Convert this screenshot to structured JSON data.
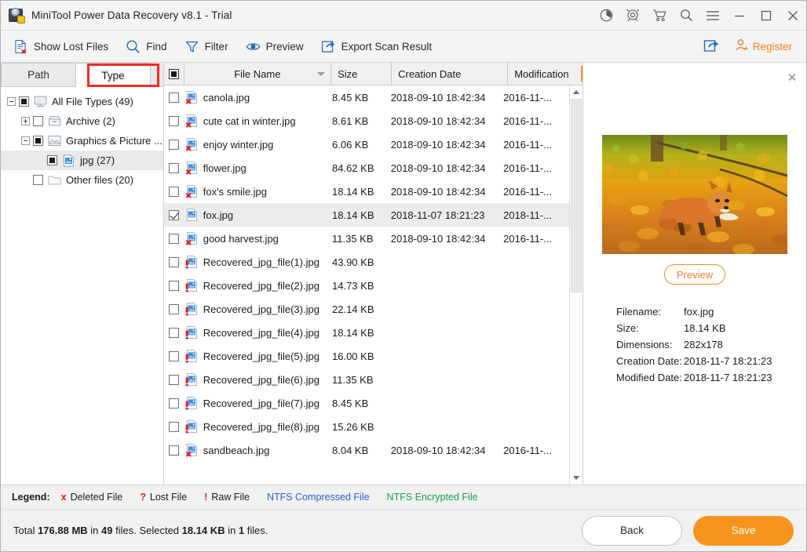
{
  "window": {
    "title": "MiniTool Power Data Recovery v8.1 - Trial",
    "app_icon": "minitool-logo-icon",
    "controls": [
      {
        "name": "disc-icon",
        "label": "Disc"
      },
      {
        "name": "support-headset-icon",
        "label": "Support"
      },
      {
        "name": "shopping-cart-icon",
        "label": "Buy"
      },
      {
        "name": "magnifier-icon",
        "label": "Search"
      },
      {
        "name": "hamburger-menu-icon",
        "label": "Menu"
      },
      {
        "name": "minimize-icon",
        "label": "Minimize"
      },
      {
        "name": "maximize-icon",
        "label": "Maximize"
      },
      {
        "name": "close-icon",
        "label": "Close"
      }
    ]
  },
  "toolbar": {
    "show_lost_files": "Show Lost Files",
    "find": "Find",
    "filter": "Filter",
    "preview": "Preview",
    "export_scan_result": "Export Scan Result",
    "register": "Register",
    "share_icon": "share-export-icon"
  },
  "tabs": {
    "path": "Path",
    "type": "Type",
    "active": "Type",
    "highlight_color": "#fb2a22"
  },
  "tree": [
    {
      "label": "All File Types (49)",
      "depth": 0,
      "expander": "minus",
      "check": "partial",
      "icon": "monitor-icon",
      "selected": false
    },
    {
      "label": "Archive (2)",
      "depth": 1,
      "expander": "plus",
      "check": "empty",
      "icon": "archive-icon",
      "selected": false
    },
    {
      "label": "Graphics & Picture ...",
      "depth": 1,
      "expander": "minus",
      "check": "partial",
      "icon": "picture-icon",
      "selected": false
    },
    {
      "label": "jpg (27)",
      "depth": 2,
      "expander": "none",
      "check": "partial",
      "icon": "jpg-file-icon",
      "selected": true
    },
    {
      "label": "Other files (20)",
      "depth": 1,
      "expander": "none",
      "check": "empty",
      "icon": "folder-icon",
      "selected": false
    }
  ],
  "filelist": {
    "columns": [
      "File Name",
      "Size",
      "Creation Date",
      "Modification"
    ],
    "header_checkbox": "partial",
    "sort_icon": "sort-descending-icon",
    "rows": [
      {
        "name": "canola.jpg",
        "size": "8.45 KB",
        "created": "2018-09-10 18:42:34",
        "modified": "2016-11-...",
        "status": "deleted",
        "checked": false,
        "selected": false
      },
      {
        "name": "cute cat in winter.jpg",
        "size": "8.61 KB",
        "created": "2018-09-10 18:42:34",
        "modified": "2016-11-...",
        "status": "deleted",
        "checked": false,
        "selected": false
      },
      {
        "name": "enjoy winter.jpg",
        "size": "6.06 KB",
        "created": "2018-09-10 18:42:34",
        "modified": "2016-11-...",
        "status": "deleted",
        "checked": false,
        "selected": false
      },
      {
        "name": "flower.jpg",
        "size": "84.62 KB",
        "created": "2018-09-10 18:42:34",
        "modified": "2016-11-...",
        "status": "deleted",
        "checked": false,
        "selected": false
      },
      {
        "name": "fox's smile.jpg",
        "size": "18.14 KB",
        "created": "2018-09-10 18:42:34",
        "modified": "2016-11-...",
        "status": "deleted",
        "checked": false,
        "selected": false
      },
      {
        "name": "fox.jpg",
        "size": "18.14 KB",
        "created": "2018-11-07 18:21:23",
        "modified": "2018-11-...",
        "status": "normal",
        "checked": true,
        "selected": true
      },
      {
        "name": "good harvest.jpg",
        "size": "11.35 KB",
        "created": "2018-09-10 18:42:34",
        "modified": "2016-11-...",
        "status": "deleted",
        "checked": false,
        "selected": false
      },
      {
        "name": "Recovered_jpg_file(1).jpg",
        "size": "43.90 KB",
        "created": "",
        "modified": "",
        "status": "raw",
        "checked": false,
        "selected": false
      },
      {
        "name": "Recovered_jpg_file(2).jpg",
        "size": "14.73 KB",
        "created": "",
        "modified": "",
        "status": "raw",
        "checked": false,
        "selected": false
      },
      {
        "name": "Recovered_jpg_file(3).jpg",
        "size": "22.14 KB",
        "created": "",
        "modified": "",
        "status": "raw",
        "checked": false,
        "selected": false
      },
      {
        "name": "Recovered_jpg_file(4).jpg",
        "size": "18.14 KB",
        "created": "",
        "modified": "",
        "status": "raw",
        "checked": false,
        "selected": false
      },
      {
        "name": "Recovered_jpg_file(5).jpg",
        "size": "16.00 KB",
        "created": "",
        "modified": "",
        "status": "raw",
        "checked": false,
        "selected": false
      },
      {
        "name": "Recovered_jpg_file(6).jpg",
        "size": "11.35 KB",
        "created": "",
        "modified": "",
        "status": "raw",
        "checked": false,
        "selected": false
      },
      {
        "name": "Recovered_jpg_file(7).jpg",
        "size": "8.45 KB",
        "created": "",
        "modified": "",
        "status": "raw",
        "checked": false,
        "selected": false
      },
      {
        "name": "Recovered_jpg_file(8).jpg",
        "size": "15.26 KB",
        "created": "",
        "modified": "",
        "status": "raw",
        "checked": false,
        "selected": false
      },
      {
        "name": "sandbeach.jpg",
        "size": "8.04 KB",
        "created": "2018-09-10 18:42:34",
        "modified": "2016-11-...",
        "status": "deleted",
        "checked": false,
        "selected": false
      }
    ]
  },
  "preview": {
    "close_icon": "close-icon",
    "image_alt": "fox in autumn leaves",
    "button_label": "Preview",
    "meta": [
      {
        "key": "Filename:",
        "value": "fox.jpg"
      },
      {
        "key": "Size:",
        "value": "18.14 KB"
      },
      {
        "key": "Dimensions:",
        "value": "282x178"
      },
      {
        "key": "Creation Date:",
        "value": "2018-11-7 18:21:23"
      },
      {
        "key": "Modified Date:",
        "value": "2018-11-7 18:21:23"
      }
    ]
  },
  "legend": {
    "title": "Legend:",
    "items": [
      {
        "mark": "x",
        "label": "Deleted File",
        "color": "#e01a1a",
        "text_color": "#1b1b1b"
      },
      {
        "mark": "?",
        "label": "Lost File",
        "color": "#e01a1a",
        "text_color": "#1b1b1b"
      },
      {
        "mark": "!",
        "label": "Raw File",
        "color": "#e01a1a",
        "text_color": "#1b1b1b"
      },
      {
        "mark": "",
        "label": "NTFS Compressed File",
        "color": "",
        "text_color": "#2c5fd8"
      },
      {
        "mark": "",
        "label": "NTFS Encrypted File",
        "color": "",
        "text_color": "#17a04b"
      }
    ]
  },
  "status": {
    "total_prefix": "Total ",
    "total_size": "176.88 MB",
    "total_mid": " in ",
    "total_count": "49",
    "total_suffix": " files.",
    "selected_prefix": "  Selected ",
    "selected_size": "18.14 KB",
    "selected_mid": " in ",
    "selected_count": "1",
    "selected_suffix": " files.",
    "back_label": "Back",
    "save_label": "Save",
    "save_color": "#f7941e"
  }
}
